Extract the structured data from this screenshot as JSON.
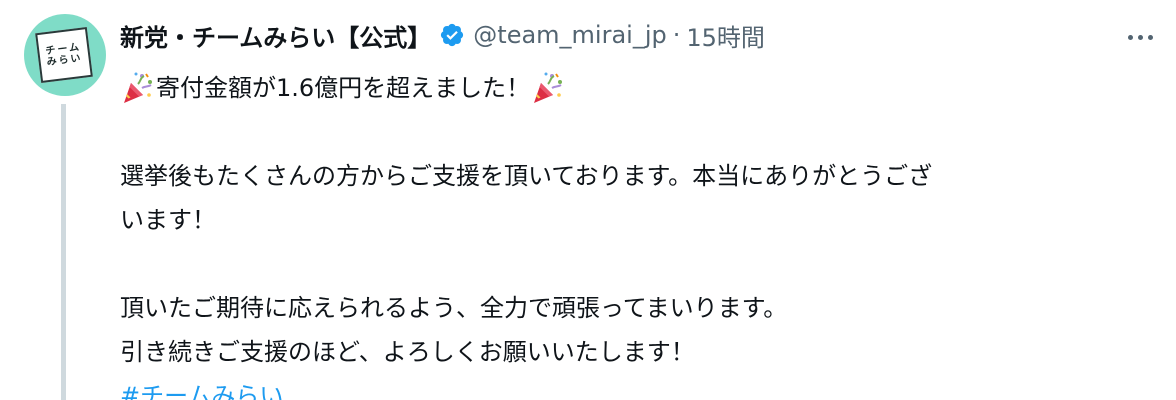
{
  "author": {
    "display_name": "新党・チームみらい【公式】",
    "handle": "@team_mirai_jp",
    "separator": "·",
    "time": "15時間",
    "avatar_text": [
      "チーム",
      "みらい"
    ]
  },
  "tweet": {
    "line1": "寄付金額が1.6億円を超えました！",
    "line2": "選挙後もたくさんの方からご支援を頂いております。本当にありがとうござ",
    "line3": "います！",
    "line4": "頂いたご期待に応えられるよう、全力で頑張ってまいります。",
    "line5": "引き続きご支援のほど、よろしくお願いいたします！",
    "hashtag": "#チームみらい"
  },
  "icons": {
    "verified": "verified-badge-icon",
    "more": "more-options-icon",
    "emoji": "party-popper-icon"
  },
  "colors": {
    "verified": "#1d9bf0",
    "hashtag": "#1d9bf0",
    "secondary_text": "#536471",
    "avatar_bg": "#7fdcc7",
    "thread_line": "#cfd9de"
  }
}
